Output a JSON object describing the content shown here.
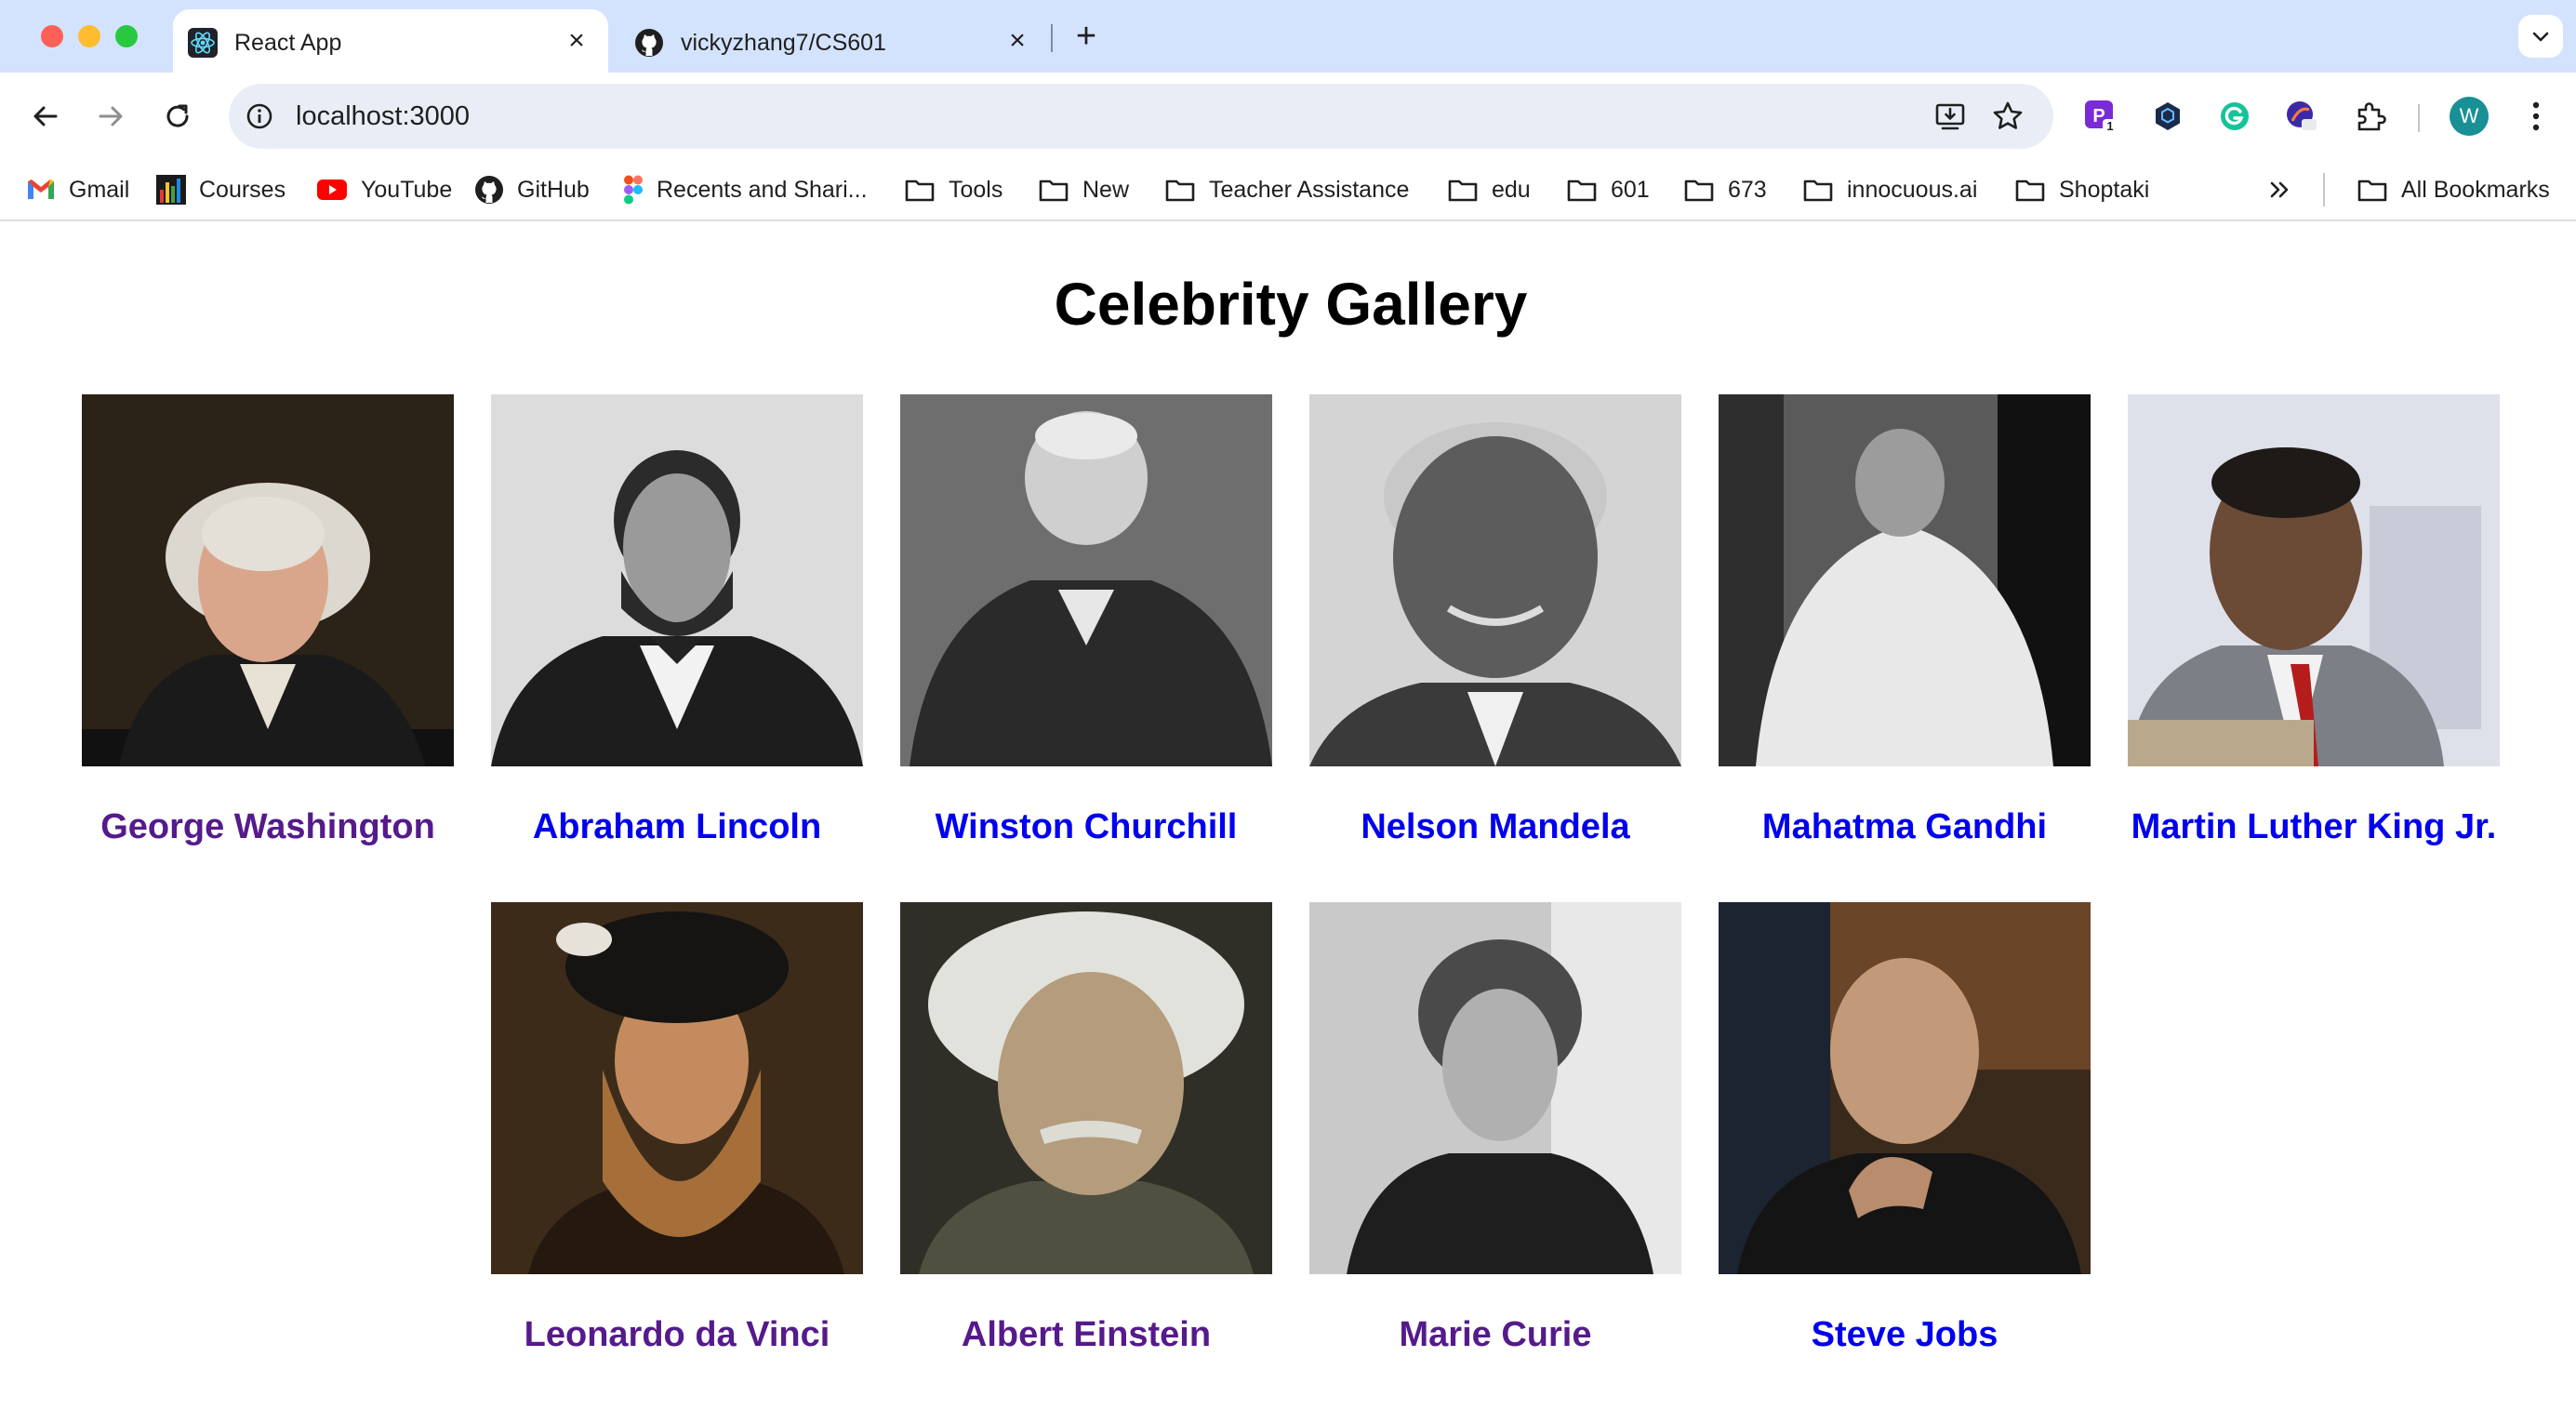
{
  "browser": {
    "tabs": [
      {
        "title": "React App",
        "active": true,
        "favicon": "react-icon"
      },
      {
        "title": "vickyzhang7/CS601",
        "active": false,
        "favicon": "github-icon"
      }
    ],
    "url": "localhost:3000",
    "profile_initial": "W",
    "extension_badge": "1",
    "bookmarks": [
      {
        "label": "Gmail",
        "icon": "gmail-icon"
      },
      {
        "label": "Courses",
        "icon": "bar-chart-icon"
      },
      {
        "label": "YouTube",
        "icon": "youtube-icon"
      },
      {
        "label": "GitHub",
        "icon": "github-icon"
      },
      {
        "label": "Recents and Shari...",
        "icon": "figma-icon"
      },
      {
        "label": "Tools",
        "icon": "folder-icon"
      },
      {
        "label": "New",
        "icon": "folder-icon"
      },
      {
        "label": "Teacher Assistance",
        "icon": "folder-icon"
      },
      {
        "label": "edu",
        "icon": "folder-icon"
      },
      {
        "label": "601",
        "icon": "folder-icon"
      },
      {
        "label": "673",
        "icon": "folder-icon"
      },
      {
        "label": "innocuous.ai",
        "icon": "folder-icon"
      },
      {
        "label": "Shoptaki",
        "icon": "folder-icon"
      }
    ],
    "all_bookmarks": "All Bookmarks"
  },
  "page": {
    "title": "Celebrity Gallery",
    "celebrities": [
      {
        "name": "George Washington",
        "visited": true
      },
      {
        "name": "Abraham Lincoln",
        "visited": false
      },
      {
        "name": "Winston Churchill",
        "visited": false
      },
      {
        "name": "Nelson Mandela",
        "visited": false
      },
      {
        "name": "Mahatma Gandhi",
        "visited": false
      },
      {
        "name": "Martin Luther King Jr.",
        "visited": false
      },
      {
        "name": "Leonardo da Vinci",
        "visited": true
      },
      {
        "name": "Albert Einstein",
        "visited": true
      },
      {
        "name": "Marie Curie",
        "visited": true
      },
      {
        "name": "Steve Jobs",
        "visited": false
      }
    ]
  },
  "colors": {
    "tabstrip": "#d3e3fd",
    "link_visited": "#551a8b",
    "link_unvisited": "#0000ee"
  }
}
